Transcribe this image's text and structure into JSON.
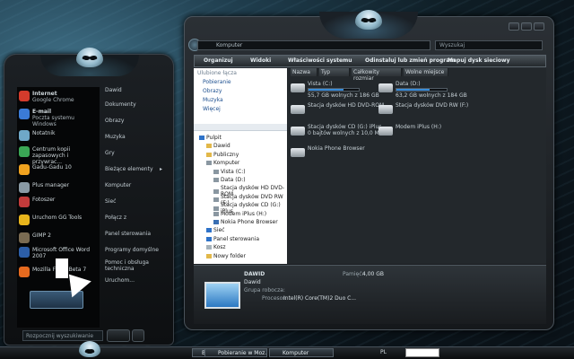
{
  "start_menu": {
    "programs": [
      {
        "title": "Internet",
        "subtitle": "Google Chrome",
        "icon": "chrome-icon",
        "color": "#d33b2c"
      },
      {
        "title": "E-mail",
        "subtitle": "Poczta systemu Windows",
        "icon": "mail-icon",
        "color": "#3b7bd6"
      },
      {
        "title": "Notatnik",
        "subtitle": "",
        "icon": "notepad-icon",
        "color": "#6fa8c8"
      },
      {
        "title": "Centrum kopii zapasowych i przywrac...",
        "subtitle": "",
        "icon": "backup-icon",
        "color": "#3aa655"
      },
      {
        "title": "Gadu-Gadu 10",
        "subtitle": "",
        "icon": "gadugadu-icon",
        "color": "#f0a21f"
      },
      {
        "title": "Plus manager",
        "subtitle": "",
        "icon": "plus-manager-icon",
        "color": "#8a9aa5"
      },
      {
        "title": "Fotoszer",
        "subtitle": "",
        "icon": "fotoszer-icon",
        "color": "#c23b3b"
      },
      {
        "title": "Uruchom GG Tools",
        "subtitle": "",
        "icon": "gg-tools-icon",
        "color": "#e8b51c"
      },
      {
        "title": "GIMP 2",
        "subtitle": "",
        "icon": "gimp-icon",
        "color": "#7a6b52"
      },
      {
        "title": "Microsoft Office Word 2007",
        "subtitle": "",
        "icon": "word-icon",
        "color": "#2c5ea8"
      },
      {
        "title": "Mozilla Fi... 3 Beta 7",
        "subtitle": "",
        "icon": "firefox-icon",
        "color": "#e66a1f"
      }
    ],
    "places": [
      {
        "label": "Dawid",
        "has_arrow": false
      },
      {
        "label": "Dokumenty",
        "has_arrow": false
      },
      {
        "label": "Obrazy",
        "has_arrow": false
      },
      {
        "label": "Muzyka",
        "has_arrow": false
      },
      {
        "label": "Gry",
        "has_arrow": false
      },
      {
        "label": "Bieżące elementy",
        "has_arrow": true
      },
      {
        "label": "Komputer",
        "has_arrow": false
      },
      {
        "label": "Sieć",
        "has_arrow": false
      },
      {
        "label": "Połącz z",
        "has_arrow": false
      },
      {
        "label": "Panel sterowania",
        "has_arrow": false
      },
      {
        "label": "Programy domyślne",
        "has_arrow": false
      },
      {
        "label": "Pomoc i obsługa techniczna",
        "has_arrow": false
      },
      {
        "label": "Uruchom...",
        "has_arrow": false
      }
    ],
    "search_placeholder": "Rozpocznij wyszukiwanie"
  },
  "explorer": {
    "address": "Komputer",
    "search_placeholder": "Wyszukaj",
    "toolbar": [
      "Organizuj",
      "Widoki",
      "Właściwości systemu",
      "Odinstaluj lub zmień program",
      "Mapuj dysk sieciowy"
    ],
    "favorites_title": "Ulubione łącza",
    "favorites": [
      "Pobieranie",
      "Obrazy",
      "Muzyka",
      "Więcej"
    ],
    "tree": [
      {
        "label": "Pulpit",
        "indent": 0,
        "color": "#2f73c9"
      },
      {
        "label": "Dawid",
        "indent": 1,
        "color": "#e2b84a"
      },
      {
        "label": "Publiczny",
        "indent": 1,
        "color": "#e2b84a"
      },
      {
        "label": "Komputer",
        "indent": 1,
        "color": "#8a97a1"
      },
      {
        "label": "Vista (C:)",
        "indent": 2,
        "color": "#8a97a1"
      },
      {
        "label": "Data (D:)",
        "indent": 2,
        "color": "#8a97a1"
      },
      {
        "label": "Stacja dysków HD DVD-ROM",
        "indent": 2,
        "color": "#8a97a1"
      },
      {
        "label": "Stacja dysków DVD RW (F:)",
        "indent": 2,
        "color": "#8a97a1"
      },
      {
        "label": "Stacja dysków CD (G:) iPlus",
        "indent": 2,
        "color": "#8a97a1"
      },
      {
        "label": "Modem iPlus (H:)",
        "indent": 2,
        "color": "#8a97a1"
      },
      {
        "label": "Nokia Phone Browser",
        "indent": 2,
        "color": "#3a6fb3"
      },
      {
        "label": "Sieć",
        "indent": 1,
        "color": "#2f73c9"
      },
      {
        "label": "Panel sterowania",
        "indent": 1,
        "color": "#2f73c9"
      },
      {
        "label": "Kosz",
        "indent": 1,
        "color": "#a7b3bb"
      },
      {
        "label": "Nowy folder",
        "indent": 1,
        "color": "#e2b84a"
      }
    ],
    "columns": [
      "Nazwa",
      "Typ",
      "Całkowity rozmiar",
      "Wolne miejsce"
    ],
    "drives": [
      {
        "name": "Vista (C:)",
        "free": "55,7 GB wolnych z 186 GB",
        "fill": 0.7,
        "icon": "hard-drive-icon"
      },
      {
        "name": "Data (D:)",
        "free": "63,2 GB wolnych z 184 GB",
        "fill": 0.66,
        "icon": "hard-drive-icon"
      },
      {
        "name": "Stacja dysków HD DVD-ROM",
        "free": "",
        "fill": null,
        "icon": "hd-dvd-icon"
      },
      {
        "name": "Stacja dysków DVD RW (F:)",
        "free": "",
        "fill": null,
        "icon": "dvd-drive-icon"
      },
      {
        "name": "Stacja dysków CD (G:) iPlus",
        "free": "0 bajtów wolnych z 10,0 MB",
        "fill": null,
        "icon": "cd-drive-icon"
      },
      {
        "name": "Modem iPlus (H:)",
        "free": "",
        "fill": null,
        "icon": "modem-drive-icon"
      },
      {
        "name": "Nokia Phone Browser",
        "free": "",
        "fill": null,
        "icon": "phone-icon"
      }
    ],
    "details": {
      "name": "DAWID",
      "workgroup_label": "Grupa robocza:",
      "workgroup": "Dawid",
      "processor_label": "Procesor:",
      "processor": "Intel(R) Core(TM)2 Duo C...",
      "memory_label": "Pamięć:",
      "memory": "4,00 GB"
    }
  },
  "taskbar": {
    "buttons": [
      "Bez tytułu - Paint",
      "Pobieranie w Moz...",
      "Komputer"
    ],
    "lang": "PL"
  }
}
